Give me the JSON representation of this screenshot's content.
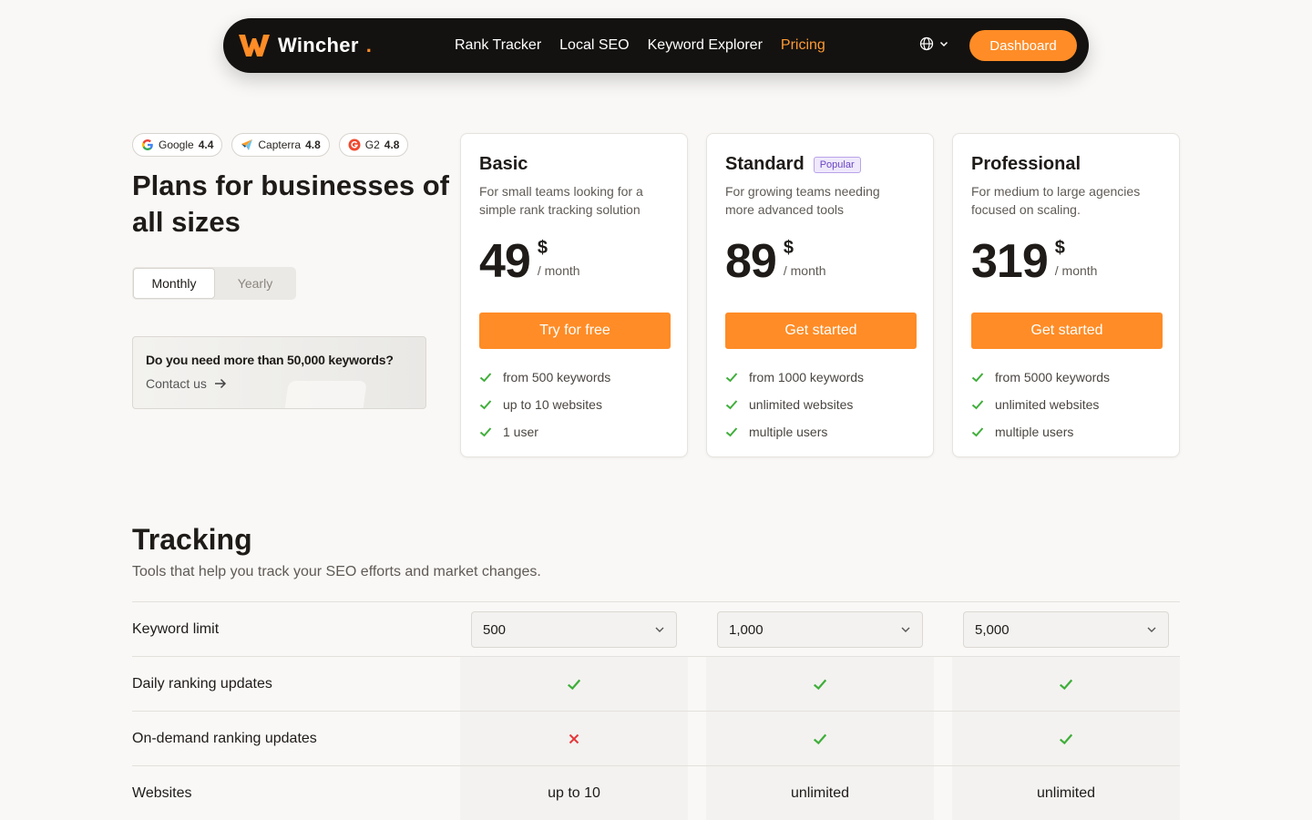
{
  "nav": {
    "brand": "Wincher",
    "brand_dot": ".",
    "links": [
      "Rank Tracker",
      "Local SEO",
      "Keyword Explorer",
      "Pricing"
    ],
    "active_link": "Pricing",
    "dashboard_label": "Dashboard"
  },
  "ratings": [
    {
      "name": "Google",
      "score": "4.4",
      "icon": "google-icon"
    },
    {
      "name": "Capterra",
      "score": "4.8",
      "icon": "capterra-icon"
    },
    {
      "name": "G2",
      "score": "4.8",
      "icon": "g2-icon"
    }
  ],
  "headline": "Plans for businesses of all sizes",
  "billing_toggle": {
    "monthly": "Monthly",
    "yearly": "Yearly",
    "selected": "Monthly"
  },
  "contact": {
    "question": "Do you need more than 50,000 keywords?",
    "link": "Contact us"
  },
  "plans": [
    {
      "name": "Basic",
      "badge": "",
      "description": "For small teams looking for a simple rank tracking solution",
      "price": "49",
      "currency": "$",
      "period": "/ month",
      "cta": "Try for free",
      "features": [
        "from 500 keywords",
        "up to 10 websites",
        "1 user"
      ]
    },
    {
      "name": "Standard",
      "badge": "Popular",
      "description": "For growing teams needing more advanced tools",
      "price": "89",
      "currency": "$",
      "period": "/ month",
      "cta": "Get started",
      "features": [
        "from 1000 keywords",
        "unlimited websites",
        "multiple users"
      ]
    },
    {
      "name": "Professional",
      "badge": "",
      "description": "For medium to large agencies focused on scaling.",
      "price": "319",
      "currency": "$",
      "period": "/ month",
      "cta": "Get started",
      "features": [
        "from 5000 keywords",
        "unlimited websites",
        "multiple users"
      ]
    }
  ],
  "tracking": {
    "title": "Tracking",
    "subtitle": "Tools that help you track your SEO efforts and market changes.",
    "rows": [
      {
        "label": "Keyword limit",
        "type": "select",
        "values": [
          "500",
          "1,000",
          "5,000"
        ]
      },
      {
        "label": "Daily ranking updates",
        "type": "bool",
        "values": [
          true,
          true,
          true
        ]
      },
      {
        "label": "On-demand ranking updates",
        "type": "bool",
        "values": [
          false,
          true,
          true
        ]
      },
      {
        "label": "Websites",
        "type": "text",
        "values": [
          "up to 10",
          "unlimited",
          "unlimited"
        ]
      }
    ]
  },
  "colors": {
    "accent": "#ff8c26",
    "check": "#3fae3a",
    "cross": "#e5383b",
    "popular": "#6a45c2"
  }
}
